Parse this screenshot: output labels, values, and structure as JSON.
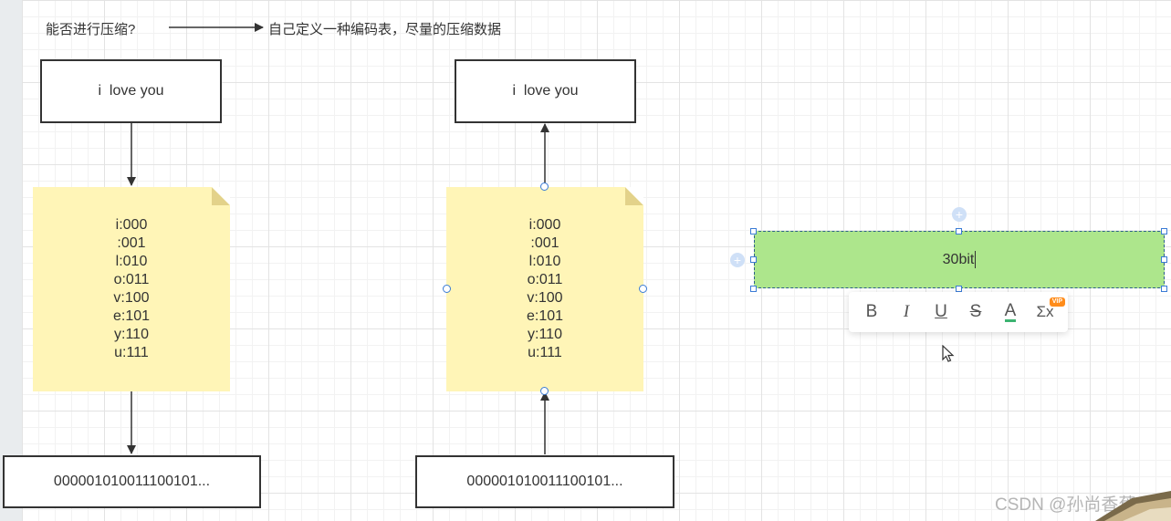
{
  "header": {
    "question": "能否进行压缩?",
    "answer": "自己定义一种编码表，尽量的压缩数据"
  },
  "left_flow": {
    "top_box": "i  love you",
    "table": [
      "i:000",
      ":001",
      "l:010",
      "o:011",
      "v:100",
      "e:101",
      "y:110",
      "u:111"
    ],
    "bottom_box": "000001010011100101..."
  },
  "right_flow": {
    "top_box": "i  love you",
    "table": [
      "i:000",
      ":001",
      "l:010",
      "o:011",
      "v:100",
      "e:101",
      "y:110",
      "u:111"
    ],
    "bottom_box": "000001010011100101..."
  },
  "selected_shape": {
    "text": "30bit"
  },
  "toolbar": {
    "bold": "B",
    "italic": "I",
    "underline": "U",
    "strike": "S",
    "font_color": "A",
    "formula": "Σx",
    "vip_badge": "VIP"
  },
  "watermark": "CSDN @孙尚香蕉",
  "colors": {
    "note_fill": "#fff5b7",
    "selected_fill": "#ade68c",
    "handle": "#3a7bd5",
    "vip": "#ff8c1a"
  }
}
